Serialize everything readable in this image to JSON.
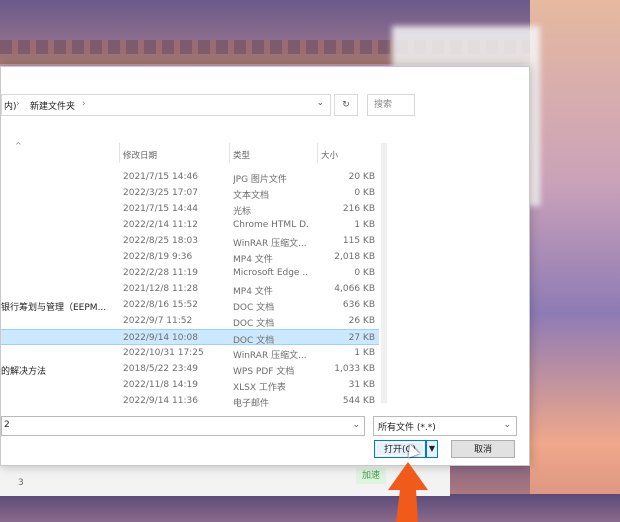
{
  "breadcrumb": {
    "prev": "内)",
    "current": "新建文件夹",
    "sep": "›"
  },
  "search": {
    "placeholder": "搜索"
  },
  "columns": {
    "date": "修改日期",
    "type": "类型",
    "size": "大小"
  },
  "files": [
    {
      "name": "",
      "date": "2021/7/15 14:46",
      "type": "JPG 图片文件",
      "size": "20 KB"
    },
    {
      "name": "",
      "date": "2022/3/25 17:07",
      "type": "文本文档",
      "size": "0 KB"
    },
    {
      "name": "",
      "date": "2021/7/15 14:44",
      "type": "光标",
      "size": "216 KB"
    },
    {
      "name": "",
      "date": "2022/2/14 11:12",
      "type": "Chrome HTML D...",
      "size": "1 KB"
    },
    {
      "name": "",
      "date": "2022/8/25 18:03",
      "type": "WinRAR 压缩文...",
      "size": "115 KB"
    },
    {
      "name": "",
      "date": "2022/8/19 9:36",
      "type": "MP4 文件",
      "size": "2,018 KB"
    },
    {
      "name": "",
      "date": "2022/2/28 11:19",
      "type": "Microsoft Edge ...",
      "size": "0 KB"
    },
    {
      "name": "",
      "date": "2021/12/8 11:28",
      "type": "MP4 文件",
      "size": "4,066 KB"
    },
    {
      "name": "银行筹划与管理（EEPM...",
      "date": "2022/8/16 15:52",
      "type": "DOC 文档",
      "size": "636 KB"
    },
    {
      "name": "",
      "date": "2022/9/7 11:52",
      "type": "DOC 文档",
      "size": "26 KB"
    },
    {
      "name": "",
      "date": "2022/9/14 10:08",
      "type": "DOC 文档",
      "size": "27 KB",
      "selected": true
    },
    {
      "name": "",
      "date": "2022/10/31 17:25",
      "type": "WinRAR 压缩文...",
      "size": "1 KB"
    },
    {
      "name": "的解决方法",
      "date": "2018/5/22 23:49",
      "type": "WPS PDF 文档",
      "size": "1,033 KB"
    },
    {
      "name": "",
      "date": "2022/11/8 14:19",
      "type": "XLSX 工作表",
      "size": "31 KB"
    },
    {
      "name": "",
      "date": "2022/9/14 11:36",
      "type": "电子邮件",
      "size": "544 KB"
    }
  ],
  "filename": {
    "value": "2"
  },
  "filetype": {
    "value": "所有文件 (*.*)"
  },
  "buttons": {
    "open": "打开(O)",
    "cancel": "取消"
  },
  "under_window": {
    "num": "3",
    "green": "加速"
  },
  "colors": {
    "accent": "#0078d7",
    "selection": "#cce8ff",
    "arrow": "#f05a1a"
  }
}
